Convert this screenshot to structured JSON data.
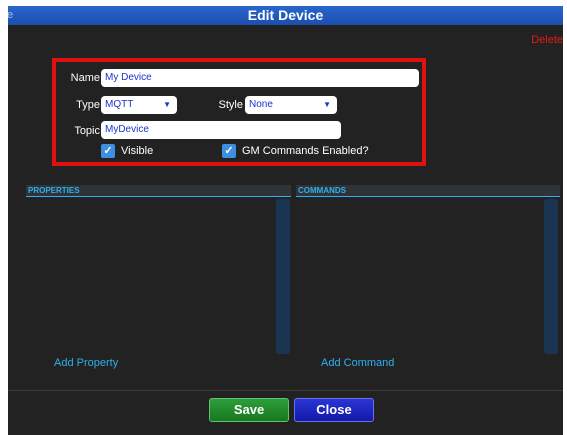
{
  "dialog": {
    "title": "Edit Device",
    "edge_char": "e",
    "delete_label": "Delete"
  },
  "form": {
    "name_label": "Name",
    "name_value": "My Device",
    "type_label": "Type",
    "type_value": "MQTT",
    "style_label": "Style",
    "style_value": "None",
    "topic_label": "Topic",
    "topic_value": "MyDevice",
    "visible_label": "Visible",
    "visible_checked": true,
    "gm_label": "GM Commands Enabled?",
    "gm_checked": true
  },
  "panels": {
    "properties_header": "PROPERTIES",
    "commands_header": "COMMANDS",
    "add_property_label": "Add Property",
    "add_command_label": "Add Command"
  },
  "footer": {
    "save_label": "Save",
    "close_label": "Close"
  },
  "colors": {
    "highlight_border": "#e01010",
    "accent": "#2eb0f0",
    "save": "#2f9d3a",
    "close": "#1219a8"
  }
}
